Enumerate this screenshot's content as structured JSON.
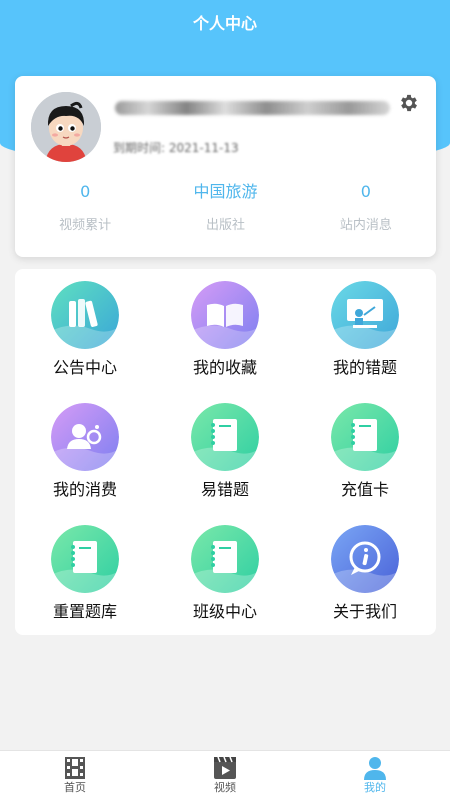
{
  "header": {
    "title": "个人中心"
  },
  "profile": {
    "username": "",
    "expire_label": "到期时间: 2021-11-13",
    "stats": [
      {
        "value": "0",
        "label": "视频累计"
      },
      {
        "value": "中国旅游",
        "label": "出版社"
      },
      {
        "value": "0",
        "label": "站内消息"
      }
    ]
  },
  "grid": {
    "items": [
      {
        "label": "公告中心",
        "icon": "books-icon"
      },
      {
        "label": "我的收藏",
        "icon": "open-book-icon"
      },
      {
        "label": "我的错题",
        "icon": "whiteboard-icon"
      },
      {
        "label": "我的消费",
        "icon": "user-coins-icon"
      },
      {
        "label": "易错题",
        "icon": "notebook-icon"
      },
      {
        "label": "充值卡",
        "icon": "notebook-icon"
      },
      {
        "label": "重置题库",
        "icon": "notebook-icon"
      },
      {
        "label": "班级中心",
        "icon": "notebook-icon"
      },
      {
        "label": "关于我们",
        "icon": "info-chat-icon"
      }
    ]
  },
  "nav": {
    "items": [
      {
        "label": "首页",
        "icon": "film-icon"
      },
      {
        "label": "视频",
        "icon": "video-play-icon"
      },
      {
        "label": "我的",
        "icon": "user-icon"
      }
    ],
    "active_color": "#4fb6ec"
  },
  "colors": {
    "brand": "#57c4fb",
    "accent": "#4fb6ec"
  }
}
